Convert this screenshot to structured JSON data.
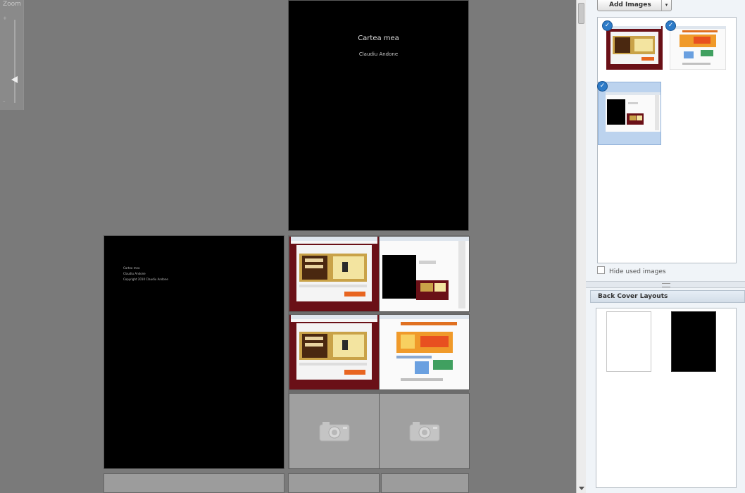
{
  "zoom": {
    "label": "Zoom",
    "plus": "+",
    "minus": "–",
    "level_fraction": 0.3
  },
  "front_cover": {
    "title": "Cartea mea",
    "author": "Claudiu Andone"
  },
  "left_page": {
    "lines": [
      "Cartea mea",
      "Claudiu Andone",
      "Copyright 2010 Claudiu Andone"
    ]
  },
  "photo_grid": {
    "cells": [
      {
        "kind": "screenshot",
        "variant": "maroon-banner"
      },
      {
        "kind": "screenshot",
        "variant": "white-dialog"
      },
      {
        "kind": "screenshot",
        "variant": "maroon-banner"
      },
      {
        "kind": "screenshot",
        "variant": "orange-web"
      },
      {
        "kind": "placeholder",
        "icon": "camera-icon"
      },
      {
        "kind": "placeholder",
        "icon": "camera-icon"
      }
    ]
  },
  "panel": {
    "add_images_label": "Add Images",
    "dropdown_glyph": "▾",
    "check_glyph": "✓",
    "hide_used_label": "Hide used images",
    "back_cover_header": "Back Cover Layouts"
  },
  "colors": {
    "canvas": "#7a7a7a",
    "accent": "#2d7bc8",
    "selection": "#bcd3ee",
    "cover": "#000000"
  }
}
